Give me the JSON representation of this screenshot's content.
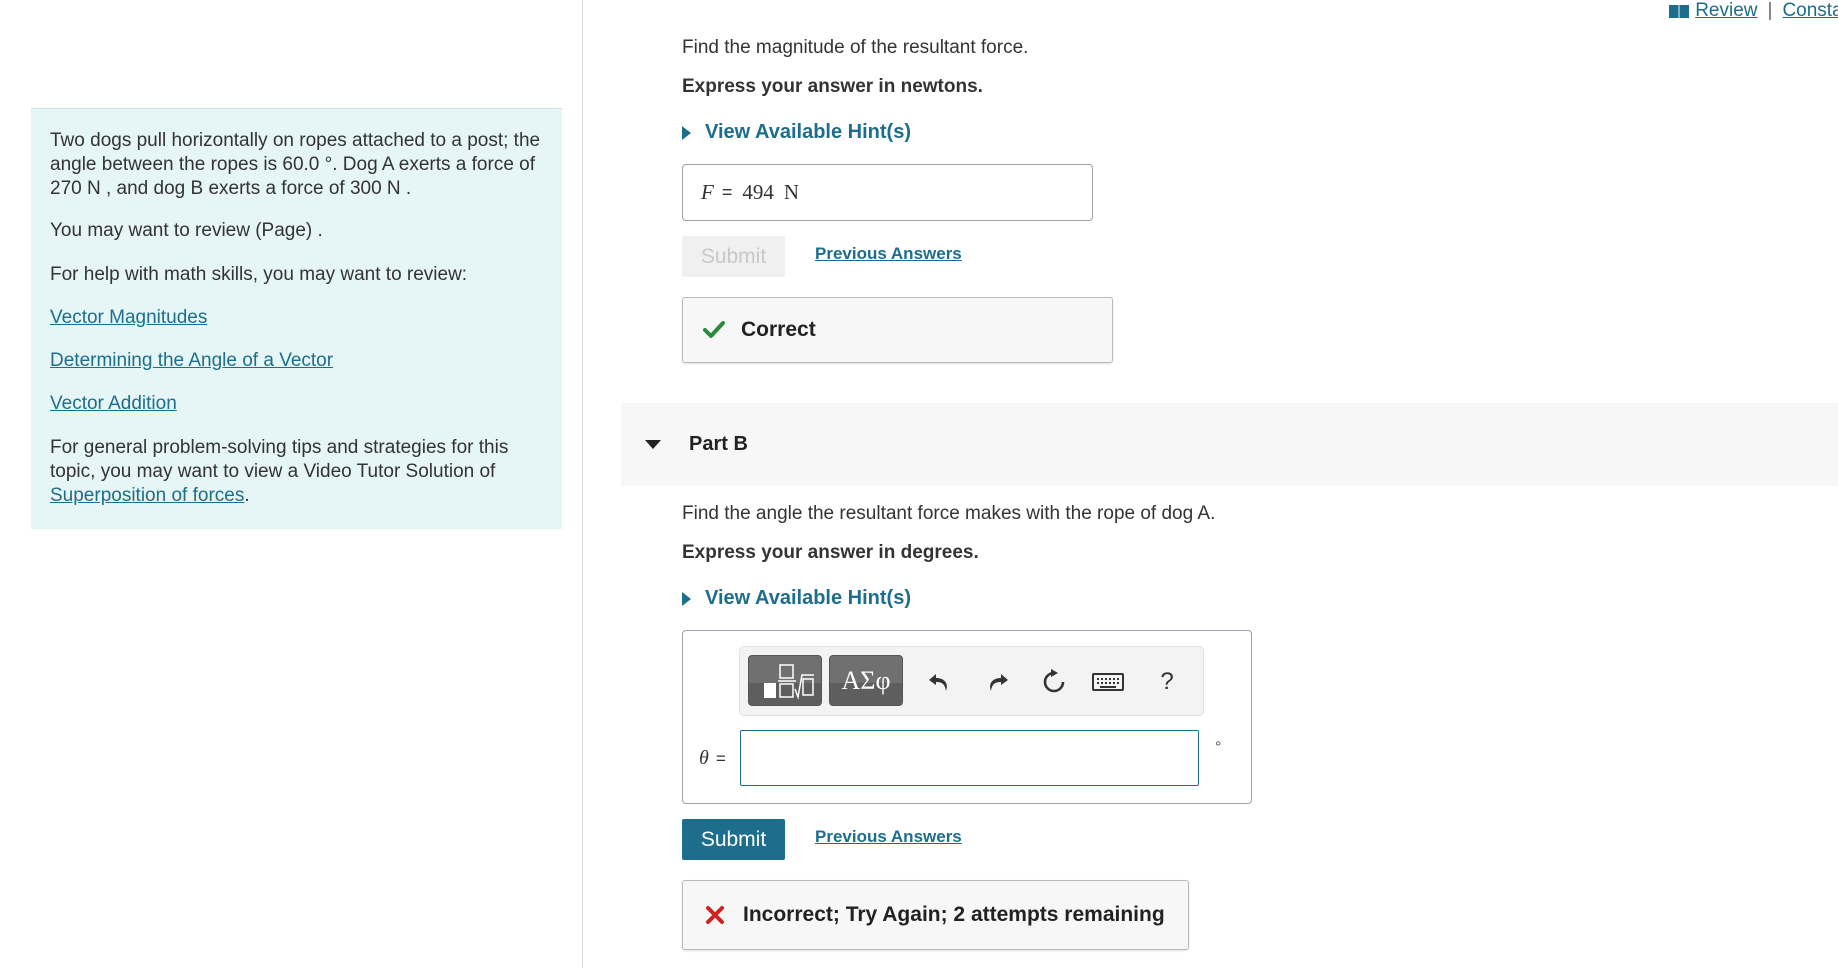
{
  "topbar": {
    "review_label": "Review",
    "separator": "|",
    "constants_label": "Constants"
  },
  "intro": {
    "problem": "Two dogs pull horizontally on ropes attached to a post; the angle between the ropes is 60.0 °. Dog A exerts a force of 270 N , and dog B exerts a force of 300 N .",
    "review_page": "You may want to review (Page) .",
    "math_help": "For help with math skills, you may want to review:",
    "links": [
      "Vector Magnitudes",
      "Determining the Angle of a Vector",
      "Vector Addition"
    ],
    "tips_text": "For general problem-solving tips and strategies for this topic, you may want to view a Video Tutor Solution of",
    "tips_link": "Superposition of forces",
    "tips_end": "."
  },
  "part_a": {
    "question": "Find the magnitude of the resultant force.",
    "express": "Express your answer in newtons.",
    "hint_label": "View Available Hint(s)",
    "var": "F",
    "equals": "=",
    "answer_value": "494",
    "unit": "N",
    "submit_label": "Submit",
    "previous_label": "Previous Answers",
    "feedback": "Correct"
  },
  "part_b": {
    "title": "Part B",
    "question": "Find the angle the resultant force makes with the rope of dog A.",
    "express": "Express your answer in degrees.",
    "hint_label": "View Available Hint(s)",
    "toolbar": {
      "greek_label": "ΑΣφ",
      "help_label": "?"
    },
    "var": "θ",
    "equals": "=",
    "answer_value": "",
    "unit": "°",
    "submit_label": "Submit",
    "previous_label": "Previous Answers",
    "feedback": "Incorrect; Try Again; 2 attempts remaining"
  },
  "colors": {
    "accent": "#1c6e8c",
    "correct": "#2a8a3b",
    "incorrect": "#d0221f",
    "panel": "#e6f5f5"
  }
}
